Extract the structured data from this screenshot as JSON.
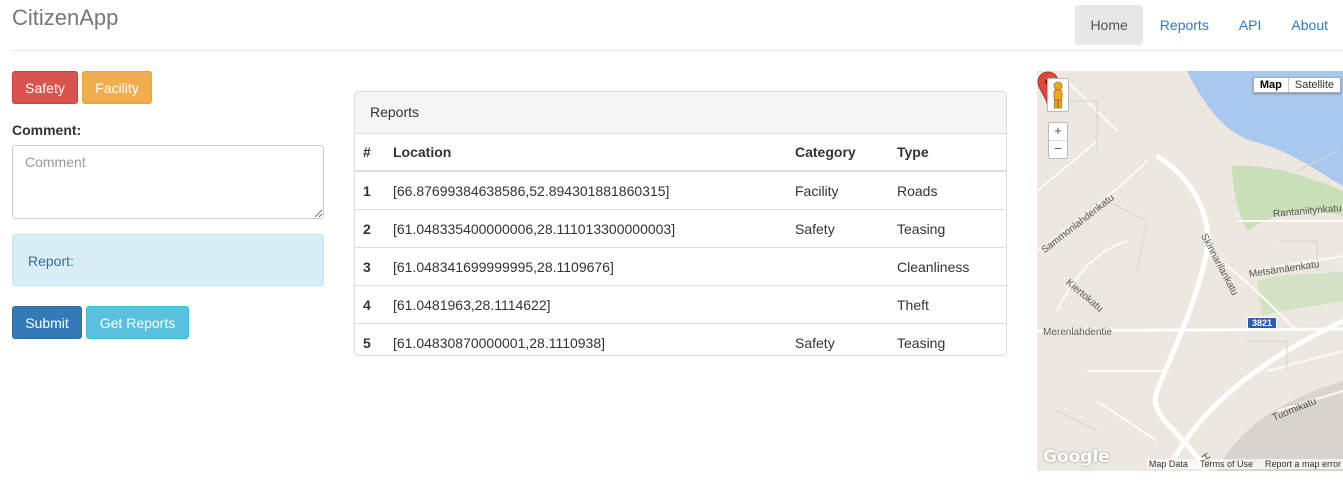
{
  "brand": "CitizenApp",
  "nav": {
    "items": [
      "Home",
      "Reports",
      "API",
      "About"
    ],
    "active": "Home"
  },
  "form": {
    "safety_label": "Safety",
    "facility_label": "Facility",
    "comment_label": "Comment:",
    "comment_placeholder": "Comment",
    "comment_value": "",
    "report_text": "Report:",
    "submit_label": "Submit",
    "get_reports_label": "Get Reports"
  },
  "reports": {
    "heading": "Reports",
    "columns": [
      "#",
      "Location",
      "Category",
      "Type"
    ],
    "rows": [
      {
        "num": "1",
        "location": "[66.87699384638586,52.894301881860315]",
        "category": "Facility",
        "type": "Roads"
      },
      {
        "num": "2",
        "location": "[61.048335400000006,28.111013300000003]",
        "category": "Safety",
        "type": "Teasing"
      },
      {
        "num": "3",
        "location": "[61.048341699999995,28.1109676]",
        "category": "",
        "type": "Cleanliness"
      },
      {
        "num": "4",
        "location": "[61.0481963,28.1114622]",
        "category": "",
        "type": "Theft"
      },
      {
        "num": "5",
        "location": "[61.04830870000001,28.1110938]",
        "category": "Safety",
        "type": "Teasing"
      }
    ]
  },
  "map": {
    "type_buttons": [
      "Map",
      "Satellite"
    ],
    "selected_type": "Map",
    "zoom_in": "+",
    "zoom_out": "−",
    "streets": [
      "Sammonlahdenkatu",
      "Kiertokatu",
      "Skinnarilankatu",
      "Rantaniitynkatu",
      "Metsämäenkatu",
      "Merenlahdentie",
      "Tuomikatu",
      "He"
    ],
    "route_number": "3821",
    "logo": "Google",
    "attribution": [
      "Map Data",
      "Terms of Use",
      "Report a map error"
    ],
    "colors": {
      "water": "#a8c8f0",
      "land": "#ece8df",
      "park": "#c9dfb8",
      "road": "#ffffff",
      "marker": "#e2453c"
    }
  }
}
